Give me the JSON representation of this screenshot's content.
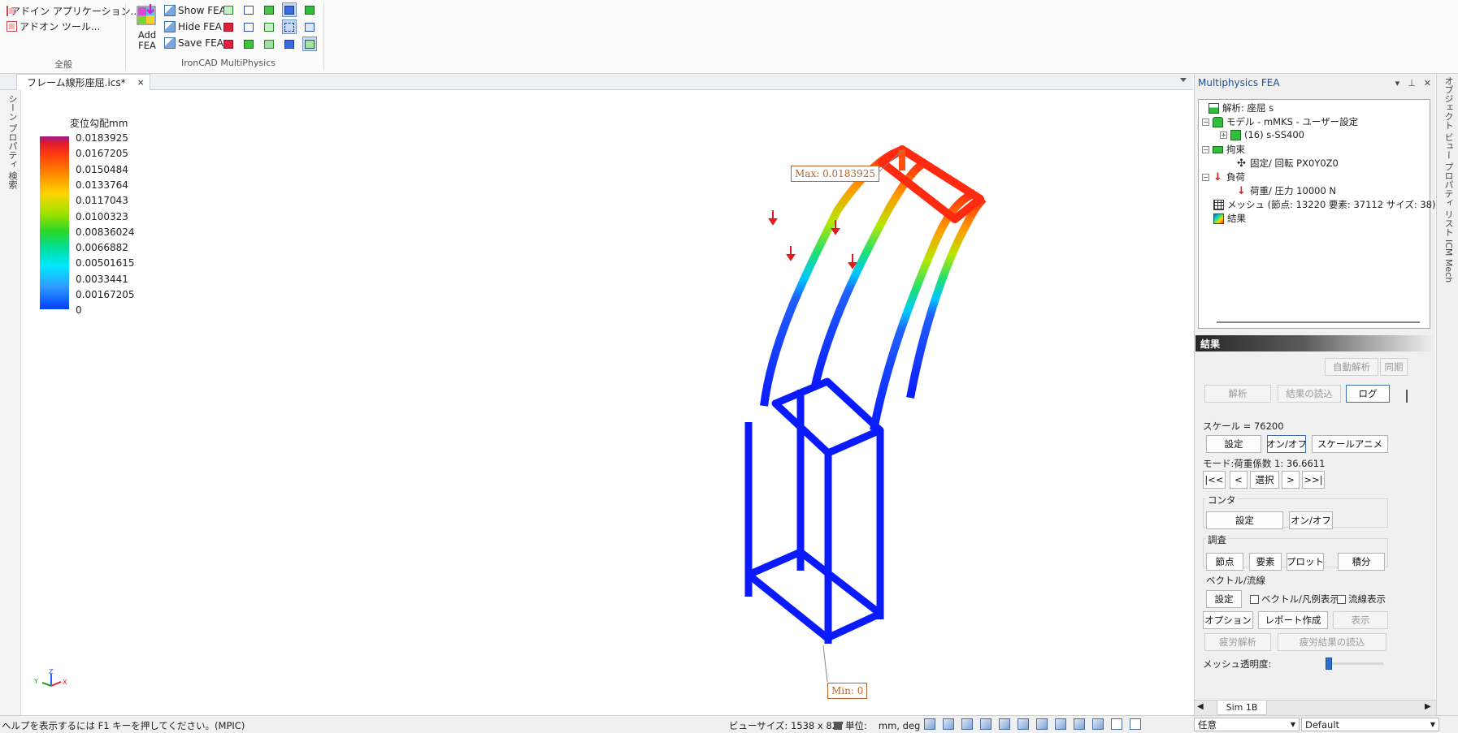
{
  "ribbon": {
    "addin_app": "アドイン アプリケーション...",
    "addon_tools": "アドオン ツール...",
    "group_general": "全般",
    "add_fea_line1": "Add",
    "add_fea_line2": "FEA",
    "show_fea": "Show FEA",
    "hide_fea": "Hide FEA",
    "save_fea": "Save FEA",
    "group_multiphysics": "IronCAD MultiPhysics"
  },
  "document": {
    "tab_title": "フレーム線形座屈.ics*",
    "close": "×",
    "left_strip": "シーン  プロパティ  検索"
  },
  "viewport": {
    "legend_title": "変位勾配mm",
    "legend_values": [
      "0.0183925",
      "0.0167205",
      "0.0150484",
      "0.0133764",
      "0.0117043",
      "0.0100323",
      "0.00836024",
      "0.0066882",
      "0.00501615",
      "0.0033441",
      "0.00167205",
      "0"
    ],
    "max_label": "Max: 0.0183925",
    "min_label": "Min: 0",
    "axis_z": "Z",
    "axis_x": "X",
    "axis_y": "Y"
  },
  "panel": {
    "title": "Multiphysics FEA",
    "tree": {
      "analysis": "解析: 座屈 s",
      "model": "モデル - mMKS - ユーザー設定",
      "part": "(16)  s-SS400",
      "constraint": "拘束",
      "fixed": "固定/ 回転 PX0Y0Z0",
      "load": "負荷",
      "load_item": "荷重/ 圧力 10000 N",
      "mesh": "メッシュ (節点: 13220   要素: 37112   サイズ: 38)",
      "results": "結果"
    },
    "results_header": "結果",
    "auto_analysis": "自動解析",
    "sync": "同期",
    "analyze": "解析",
    "read_results": "結果の読込",
    "log": "ログ",
    "scale_label": "スケール = 76200",
    "setting": "設定",
    "onoff": "オン/オフ",
    "scale_anime": "スケールアニメ",
    "mode_label": "モード:荷重係数 1: 36.6611",
    "nav_first": "|<<",
    "nav_prev": "<",
    "nav_select": "選択",
    "nav_next": ">",
    "nav_last": ">>|",
    "contour_label": "コンタ",
    "contour_setting": "設定",
    "contour_onoff": "オン/オフ",
    "probe_label": "調査",
    "node": "節点",
    "element": "要素",
    "plot": "プロット",
    "integral": "積分",
    "vector_label": "ベクトル/流線",
    "vector_setting": "設定",
    "vector_legend": "ベクトル/凡例表示",
    "streamline": "流線表示",
    "option": "オプション",
    "report": "レポート作成",
    "display": "表示",
    "fatigue": "疲労解析",
    "fatigue_read": "疲労結果の読込",
    "mesh_transparency": "メッシュ透明度:",
    "bottom_tab": "Sim 1B"
  },
  "far_right": {
    "text": "オブジェクト ビュー  プロパティ リスト  ICM Mech"
  },
  "status": {
    "help": "ヘルプを表示するには F1 キーを押してください。(MPIC)",
    "view_size": "ビューサイズ: 1538 x  827",
    "unit_label": "単位:",
    "unit_value": "mm, deg",
    "combo1": "任意",
    "combo2": "Default"
  },
  "colors": {
    "accent": "#1f4e9a",
    "max_border": "#b8642a",
    "load_arrow": "#e01b1b"
  }
}
